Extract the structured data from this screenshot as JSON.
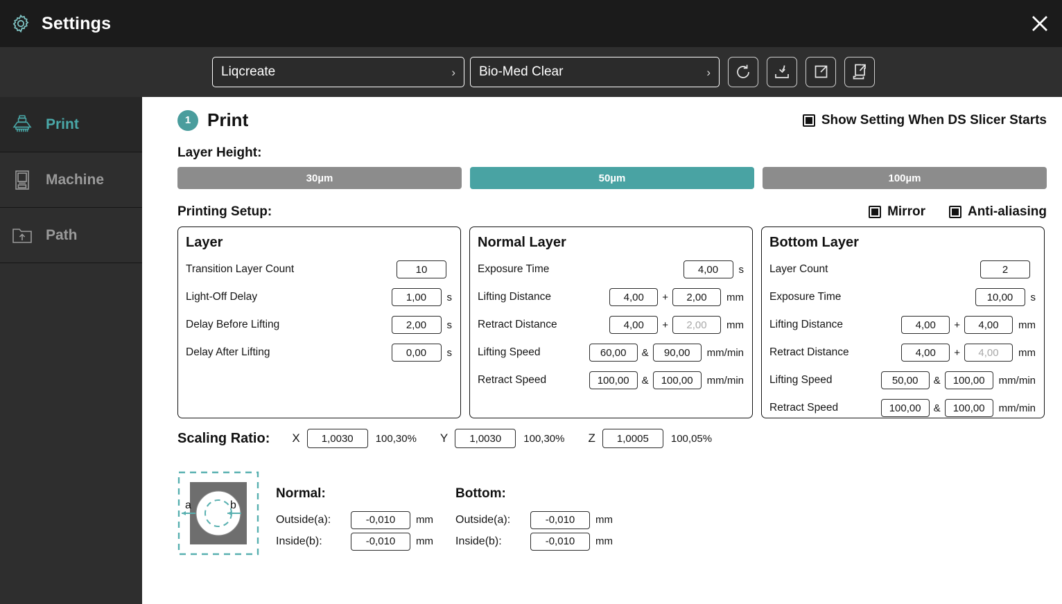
{
  "window": {
    "title": "Settings",
    "gear_icon": "gear-icon",
    "close_icon": "close-icon"
  },
  "toolbar": {
    "brand_select": {
      "value": "Liqcreate",
      "chevron": "›"
    },
    "resin_select": {
      "value": "Bio-Med Clear",
      "chevron": "›"
    },
    "buttons": [
      {
        "name": "reset-button",
        "icon": "reset-icon"
      },
      {
        "name": "import-button",
        "icon": "import-icon"
      },
      {
        "name": "export-button",
        "icon": "export-icon"
      },
      {
        "name": "export-all-button",
        "icon": "export-all-icon"
      }
    ]
  },
  "sidebar": {
    "items": [
      {
        "label": "Print",
        "icon": "printer-nozzle-icon",
        "active": true
      },
      {
        "label": "Machine",
        "icon": "machine-icon",
        "active": false
      },
      {
        "label": "Path",
        "icon": "folder-upload-icon",
        "active": false
      }
    ]
  },
  "section": {
    "step": "1",
    "title": "Print",
    "show_setting": {
      "label": "Show Setting When DS Slicer Starts",
      "checked": true
    }
  },
  "layer_height": {
    "label": "Layer Height:",
    "options": [
      {
        "label": "30µm",
        "active": false
      },
      {
        "label": "50µm",
        "active": true
      },
      {
        "label": "100µm",
        "active": false
      }
    ]
  },
  "printing_setup": {
    "label": "Printing Setup:",
    "mirror": {
      "label": "Mirror",
      "checked": true
    },
    "anti_aliasing": {
      "label": "Anti-aliasing",
      "checked": true
    }
  },
  "panels": {
    "layer": {
      "title": "Layer",
      "rows": [
        {
          "label": "Transition Layer Count",
          "value": "10",
          "unit": ""
        },
        {
          "label": "Light-Off Delay",
          "value": "1,00",
          "unit": "s"
        },
        {
          "label": "Delay Before Lifting",
          "value": "2,00",
          "unit": "s"
        },
        {
          "label": "Delay After Lifting",
          "value": "0,00",
          "unit": "s"
        }
      ]
    },
    "normal_layer": {
      "title": "Normal Layer",
      "exposure_time": {
        "label": "Exposure Time",
        "value": "4,00",
        "unit": "s"
      },
      "lifting_distance": {
        "label": "Lifting Distance",
        "value1": "4,00",
        "op": "+",
        "value2": "2,00",
        "unit": "mm",
        "value2_dim": false
      },
      "retract_distance": {
        "label": "Retract Distance",
        "value1": "4,00",
        "op": "+",
        "value2": "2,00",
        "unit": "mm",
        "value2_dim": true
      },
      "lifting_speed": {
        "label": "Lifting Speed",
        "value1": "60,00",
        "op": "&",
        "value2": "90,00",
        "unit": "mm/min",
        "value2_dim": false
      },
      "retract_speed": {
        "label": "Retract Speed",
        "value1": "100,00",
        "op": "&",
        "value2": "100,00",
        "unit": "mm/min",
        "value2_dim": false
      }
    },
    "bottom_layer": {
      "title": "Bottom Layer",
      "layer_count": {
        "label": "Layer Count",
        "value": "2",
        "unit": ""
      },
      "exposure_time": {
        "label": "Exposure Time",
        "value": "10,00",
        "unit": "s"
      },
      "lifting_distance": {
        "label": "Lifting Distance",
        "value1": "4,00",
        "op": "+",
        "value2": "4,00",
        "unit": "mm",
        "value2_dim": false
      },
      "retract_distance": {
        "label": "Retract Distance",
        "value1": "4,00",
        "op": "+",
        "value2": "4,00",
        "unit": "mm",
        "value2_dim": true
      },
      "lifting_speed": {
        "label": "Lifting Speed",
        "value1": "50,00",
        "op": "&",
        "value2": "100,00",
        "unit": "mm/min",
        "value2_dim": false
      },
      "retract_speed": {
        "label": "Retract Speed",
        "value1": "100,00",
        "op": "&",
        "value2": "100,00",
        "unit": "mm/min",
        "value2_dim": false
      }
    }
  },
  "scaling_ratio": {
    "title": "Scaling Ratio:",
    "axes": [
      {
        "axis": "X",
        "value": "1,0030",
        "percent": "100,30%"
      },
      {
        "axis": "Y",
        "value": "1,0030",
        "percent": "100,30%"
      },
      {
        "axis": "Z",
        "value": "1,0005",
        "percent": "100,05%"
      }
    ]
  },
  "compensation": {
    "diagram": {
      "name": "compensation-diagram",
      "label_outside": "a",
      "label_inside": "b"
    },
    "normal": {
      "title": "Normal:",
      "outside": {
        "label": "Outside(a):",
        "value": "-0,010",
        "unit": "mm"
      },
      "inside": {
        "label": "Inside(b):",
        "value": "-0,010",
        "unit": "mm"
      }
    },
    "bottom": {
      "title": "Bottom:",
      "outside": {
        "label": "Outside(a):",
        "value": "-0,010",
        "unit": "mm"
      },
      "inside": {
        "label": "Inside(b):",
        "value": "-0,010",
        "unit": "mm"
      }
    }
  },
  "colors": {
    "accent_teal": "#4a9d9d",
    "titlebar": "#1b1b1b",
    "toolbar": "#2f2f2f",
    "sidebar": "#2e2e2e",
    "inactive_gray": "#8c8c8c"
  }
}
